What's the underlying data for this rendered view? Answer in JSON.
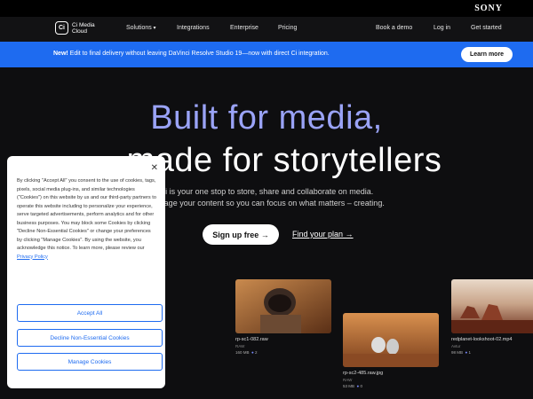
{
  "sony": {
    "logo": "SONY"
  },
  "nav": {
    "brand_mark": "Ci",
    "brand_line1": "Ci Media",
    "brand_line2": "Cloud",
    "items": [
      "Solutions",
      "Integrations",
      "Enterprise",
      "Pricing"
    ],
    "book_demo": "Book a demo",
    "login": "Log in",
    "get_started": "Get started"
  },
  "banner": {
    "new_label": "New!",
    "text": " Edit to final delivery without leaving DaVinci Resolve Studio 19—now with direct Ci integration.",
    "cta": "Learn more"
  },
  "hero": {
    "line1": "Built for media,",
    "line2": "made for storytellers",
    "sub1": "Ci is your one stop to store, share and collaborate on media.",
    "sub2": "manage your content so you can focus on what matters – creating.",
    "signup": "Sign up free →",
    "find_plan": "Find your plan →"
  },
  "tiles": [
    {
      "name": "rp-sc1-082.raw",
      "meta": "RAW",
      "size": "160 MB",
      "count": "2"
    },
    {
      "name": "rp-sc2-485.raw.jpg",
      "meta": "RAW",
      "size": "53 MB",
      "count": "0"
    },
    {
      "name": "redplanet-lookshoot-02.mp4",
      "meta": "Avtur",
      "size": "98 MB",
      "count": "1"
    }
  ],
  "cookie": {
    "close": "✕",
    "text": "By clicking \"Accept All\" you consent to the use of cookies, tags, pixels, social media plug-ins, and similar technologies (\"Cookies\") on this website by us and our third-party partners to operate this website including to personalize your experience, serve targeted advertisements, perform analytics and for other business purposes. You may block some Cookies by clicking \"Decline Non-Essential Cookies\" or change your preferences by clicking \"Manage Cookies\". By using the website, you acknowledge this notice. To learn more, please review our ",
    "policy_link": "Privacy Policy",
    "accept": "Accept All",
    "decline": "Decline Non-Essential Cookies",
    "manage": "Manage Cookies"
  },
  "colors": {
    "accent": "#1e6bf0",
    "hero_purple": "#9aa3f7",
    "bg": "#0e0e10"
  }
}
